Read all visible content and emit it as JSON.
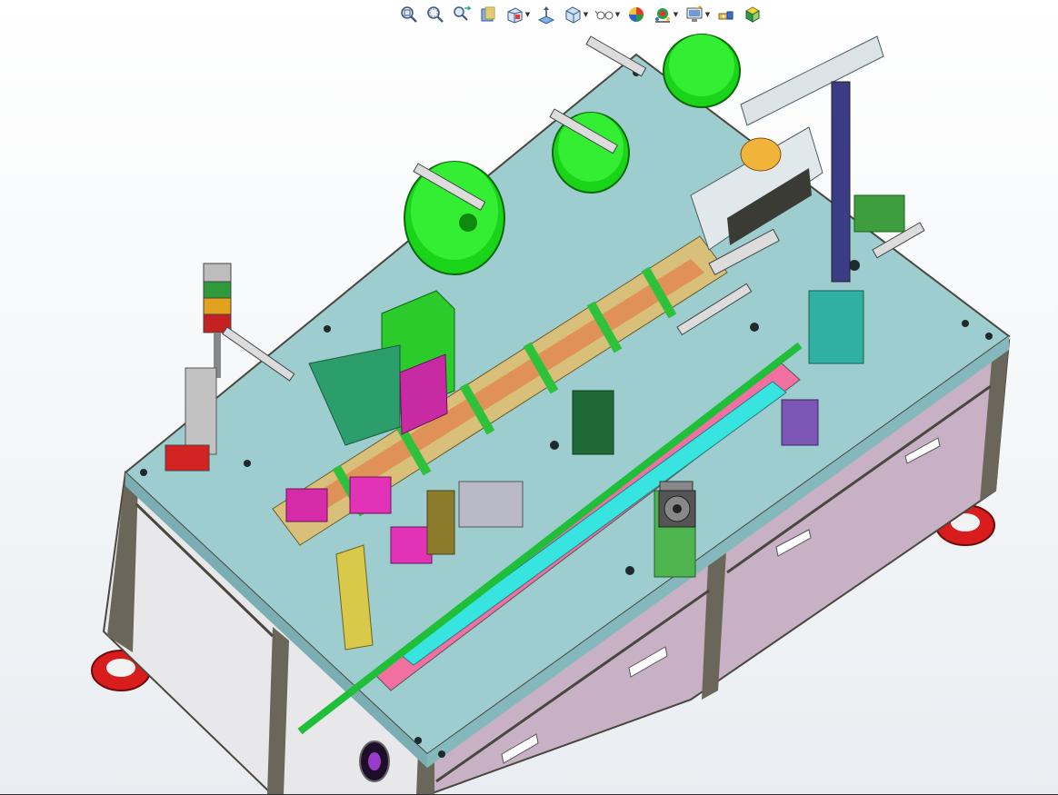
{
  "toolbar": {
    "icons": [
      "zoom-to-fit-icon",
      "zoom-area-icon",
      "previous-view-icon",
      "section-view-icon",
      "view-orientation-icon",
      "normal-to-icon",
      "display-style-icon",
      "hide-show-items-icon",
      "edit-appearance-icon",
      "apply-scene-icon",
      "view-settings-icon",
      "rotate-view-icon",
      "cursor-view-icon"
    ]
  },
  "colors": {
    "table_top": "#9ecdd0",
    "cabinet_side": "#c9b2c6",
    "cabinet_front": "#e9e9ea",
    "frame": "#5d5a50",
    "bowl": "#33ee33",
    "accent_magenta": "#e233b8",
    "accent_orange": "#ee8a27",
    "accent_cyan": "#38e4e0",
    "accent_pink": "#f07aa3",
    "foot": "#d91c1c"
  }
}
